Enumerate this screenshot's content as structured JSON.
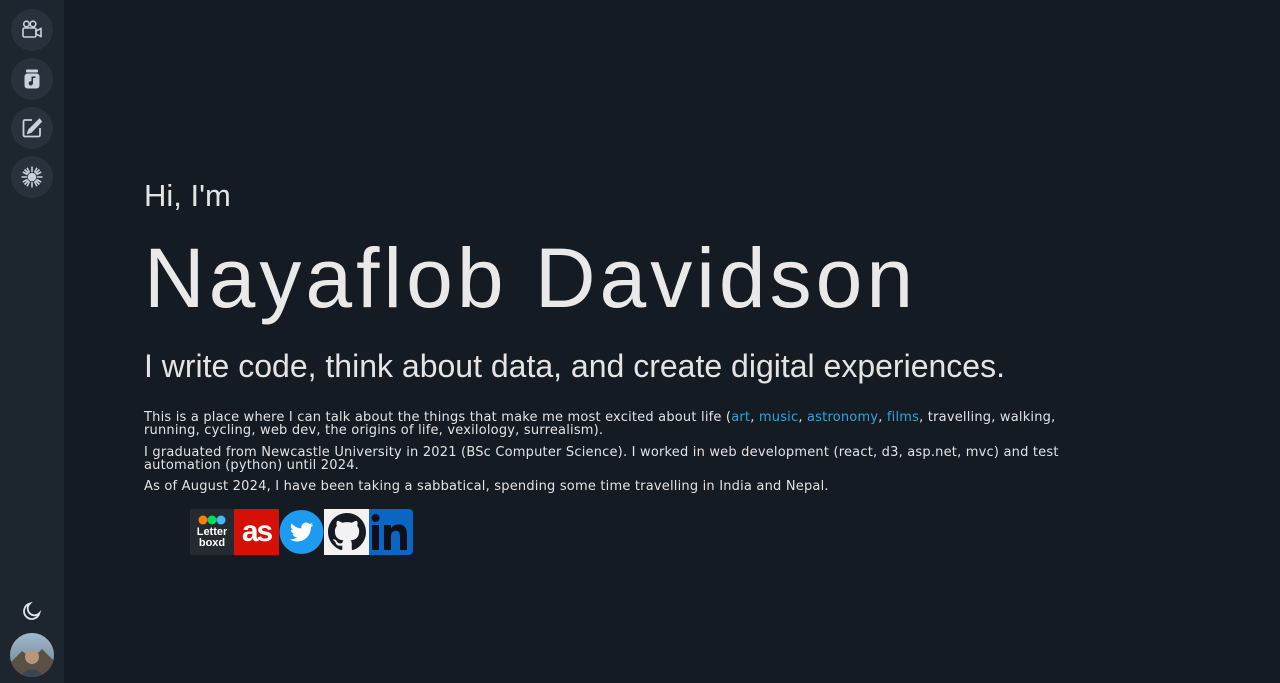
{
  "sidebar": {
    "items": [
      {
        "name": "films",
        "icon": "video-camera-icon"
      },
      {
        "name": "music",
        "icon": "music-jar-icon"
      },
      {
        "name": "blog",
        "icon": "edit-note-icon"
      },
      {
        "name": "astronomy",
        "icon": "starburst-icon"
      }
    ],
    "theme_icon": "moon-icon",
    "avatar_icon": "profile-avatar"
  },
  "hero": {
    "greeting": "Hi, I'm",
    "name": "Nayaflob Davidson",
    "tagline": "I write code, think about data, and create digital experiences."
  },
  "about": {
    "p1_before": "This is a place where I can talk about the things that make me most excited about life (",
    "link_art": "art",
    "sep1": ", ",
    "link_music": "music",
    "sep2": ", ",
    "link_astronomy": "astronomy",
    "sep3": ", ",
    "link_films": "films",
    "p1_after": ", travelling, walking, running, cycling, web dev, the origins of life, vexilology, surrealism).",
    "p2": "I graduated from Newcastle University in 2021 (BSc Computer Science). I worked in web development (react, d3, asp.net, mvc) and test automation (python) until 2024.",
    "p3": "As of August 2024, I have been taking a sabbatical, spending some time travelling in India and Nepal."
  },
  "socials": {
    "letterboxd_text_1": "Letter",
    "letterboxd_text_2": "boxd",
    "lastfm_text": "as",
    "items": [
      "letterboxd",
      "lastfm",
      "twitter",
      "github",
      "linkedin"
    ]
  },
  "colors": {
    "background": "#151b23",
    "sidebar": "#1d252f",
    "link": "#2fa3e0"
  }
}
